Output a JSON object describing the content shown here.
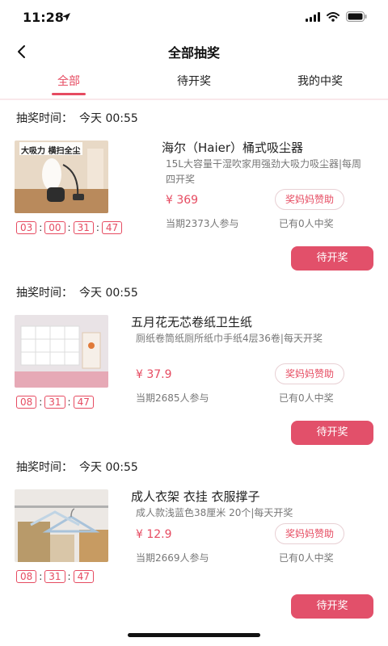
{
  "status_bar": {
    "time": "11:28"
  },
  "header": {
    "title": "全部抽奖"
  },
  "tabs": [
    {
      "label": "全部",
      "active": true
    },
    {
      "label": "待开奖",
      "active": false
    },
    {
      "label": "我的中奖",
      "active": false
    }
  ],
  "colors": {
    "accent": "#e64b61",
    "button": "#e2506a",
    "divider": "#f9e8eb"
  },
  "records": [
    {
      "draw_time_label": "抽奖时间：",
      "draw_time_value": "今天 00:55",
      "title": "海尔（Haier）桶式吸尘器",
      "description": "15L大容量干湿吹家用强劲大吸力吸尘器|每周四开奖",
      "price": "¥ 369",
      "sponsor": "奖妈妈赞助",
      "participants": "当期2373人参与",
      "winners": "已有0人中奖",
      "countdown": [
        "03",
        "00",
        "31",
        "47"
      ],
      "button": "待开奖",
      "image_text": "大吸力 横扫全尘"
    },
    {
      "draw_time_label": "抽奖时间：",
      "draw_time_value": "今天 00:55",
      "title": "五月花无芯卷纸卫生纸",
      "description": "厕纸卷筒纸厕所纸巾手纸4层36卷|每天开奖",
      "price": "¥ 37.9",
      "sponsor": "奖妈妈赞助",
      "participants": "当期2685人参与",
      "winners": "已有0人中奖",
      "countdown": [
        "08",
        "31",
        "47"
      ],
      "button": "待开奖"
    },
    {
      "draw_time_label": "抽奖时间：",
      "draw_time_value": "今天 00:55",
      "title": "成人衣架 衣挂 衣服撑子",
      "description": "成人款浅蓝色38厘米 20个|每天开奖",
      "price": "¥ 12.9",
      "sponsor": "奖妈妈赞助",
      "participants": "当期2669人参与",
      "winners": "已有0人中奖",
      "countdown": [
        "08",
        "31",
        "47"
      ],
      "button": "待开奖"
    }
  ]
}
